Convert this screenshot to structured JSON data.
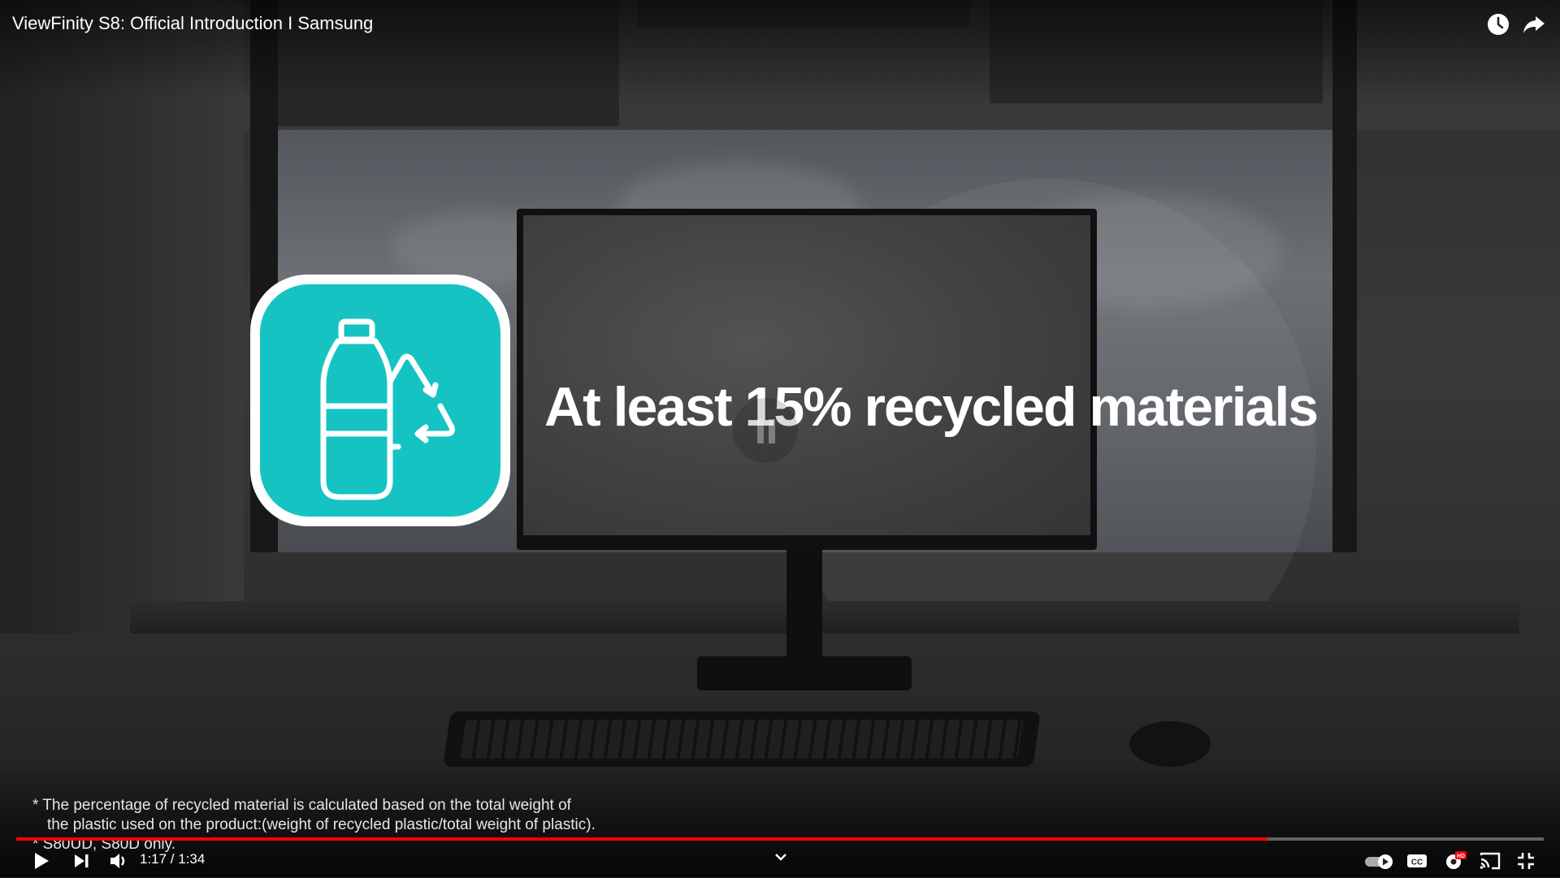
{
  "video": {
    "title": "ViewFinity S8: Official Introduction I Samsung",
    "headline": "At least 15% recycled materials",
    "disclaimer": {
      "line1": "* The percentage of recycled material is calculated based on the total weight of",
      "line2": "the plastic used on the product:(weight of recycled plastic/total weight of plastic).",
      "line3": "* S80UD, S80D only."
    }
  },
  "player": {
    "current_time": "1:17",
    "duration": "1:34",
    "time_display": "1:17 / 1:34",
    "progress_fraction": 0.819,
    "autoplay": true,
    "hd": true,
    "accent_color": "#ff0000"
  },
  "icons": {
    "watch_later": "clock-icon",
    "share": "share-icon",
    "play": "play-icon",
    "next": "next-icon",
    "volume": "volume-icon",
    "autoplay": "autoplay-toggle-icon",
    "captions": "cc-icon",
    "settings": "settings-gear-icon",
    "cast": "cast-icon",
    "fullscreen_exit": "exit-fullscreen-icon",
    "recycle": "bottle-recycle-icon"
  },
  "colors": {
    "icon_teal": "#16c3c3"
  }
}
